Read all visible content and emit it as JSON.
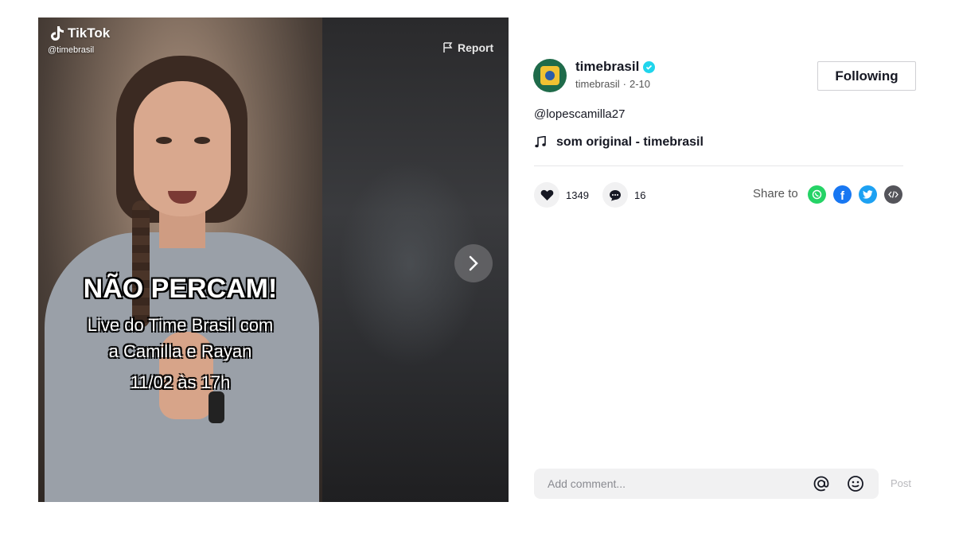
{
  "video": {
    "brand": "TikTok",
    "handle": "@timebrasil",
    "report_label": "Report",
    "overlay_lines": [
      "NÃO PERCAM!",
      "Live do Time Brasil com",
      "a Camilla e Rayan",
      "11/02 às 17h"
    ]
  },
  "author": {
    "username": "timebrasil",
    "nickname": "timebrasil",
    "date": "2-10",
    "follow_label": "Following"
  },
  "post": {
    "mention": "@lopescamilla27",
    "sound": "som original - timebrasil"
  },
  "stats": {
    "likes": "1349",
    "comments": "16"
  },
  "share": {
    "label": "Share to",
    "targets": [
      "whatsapp",
      "facebook",
      "twitter",
      "embed"
    ]
  },
  "comment": {
    "placeholder": "Add comment...",
    "post_label": "Post"
  },
  "colors": {
    "whatsapp": "#25d366",
    "facebook": "#1877f2",
    "twitter": "#1da1f2",
    "embed": "#54545a",
    "verified": "#20d5ec"
  }
}
